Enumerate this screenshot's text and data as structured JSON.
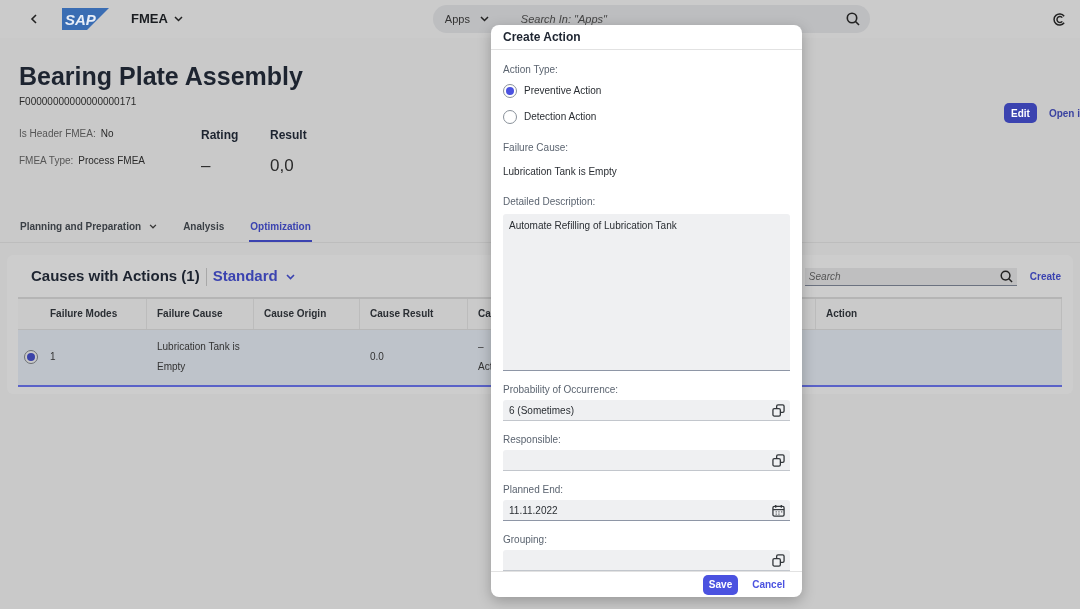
{
  "shell_bar": {
    "logo_text": "SAP",
    "app_title": "FMEA",
    "search_scope": "Apps",
    "search_placeholder": "Search In: \"Apps\""
  },
  "header": {
    "title": "Bearing Plate Assembly",
    "id": "F00000000000000000171",
    "attributes": [
      {
        "label": "Is Header FMEA:",
        "value": "No"
      },
      {
        "label": "FMEA Type:",
        "value": "Process FMEA"
      }
    ],
    "kpis": [
      {
        "label": "Rating",
        "value": "–"
      },
      {
        "label": "Result",
        "value": "0,0"
      }
    ],
    "actions": [
      {
        "kind": "primary",
        "label": "Edit"
      },
      {
        "kind": "link",
        "label": "Open i"
      }
    ]
  },
  "tabs": [
    {
      "label": "Planning and Preparation",
      "dropdown": true,
      "selected": false
    },
    {
      "label": "Analysis",
      "dropdown": false,
      "selected": false
    },
    {
      "label": "Optimization",
      "dropdown": false,
      "selected": true
    }
  ],
  "table": {
    "title": "Causes with Actions (1)",
    "variant": "Standard",
    "search_placeholder": "Search",
    "create": "Create",
    "columns": [
      "Failure Modes",
      "Failure Cause",
      "Cause Origin",
      "Cause Result",
      "Ca",
      "Action"
    ],
    "rows": [
      {
        "selected": true,
        "cells": [
          "1",
          "Lubrication Tank is Empty",
          "",
          "0.0",
          "–\nAct",
          ""
        ]
      }
    ]
  },
  "dialog": {
    "title": "Create Action",
    "action_type_label": "Action Type:",
    "action_types": [
      {
        "label": "Preventive Action",
        "selected": true
      },
      {
        "label": "Detection Action",
        "selected": false
      }
    ],
    "failure_cause_label": "Failure Cause:",
    "failure_cause": "Lubrication Tank is Empty",
    "description_label": "Detailed Description:",
    "description": "Automate Refilling of Lubrication Tank",
    "fields": [
      {
        "label": "Probability of Occurrence:",
        "value": "6 (Sometimes)",
        "kind": "valuehelp"
      },
      {
        "label": "Responsible:",
        "kind": "valuehelp"
      },
      {
        "label": "Planned End:",
        "value": "11.11.2022",
        "kind": "date"
      },
      {
        "label": "Grouping:",
        "kind": "valuehelp"
      }
    ],
    "buttons": [
      {
        "kind": "primary",
        "label": "Save"
      },
      {
        "kind": "link",
        "label": "Cancel"
      }
    ]
  }
}
